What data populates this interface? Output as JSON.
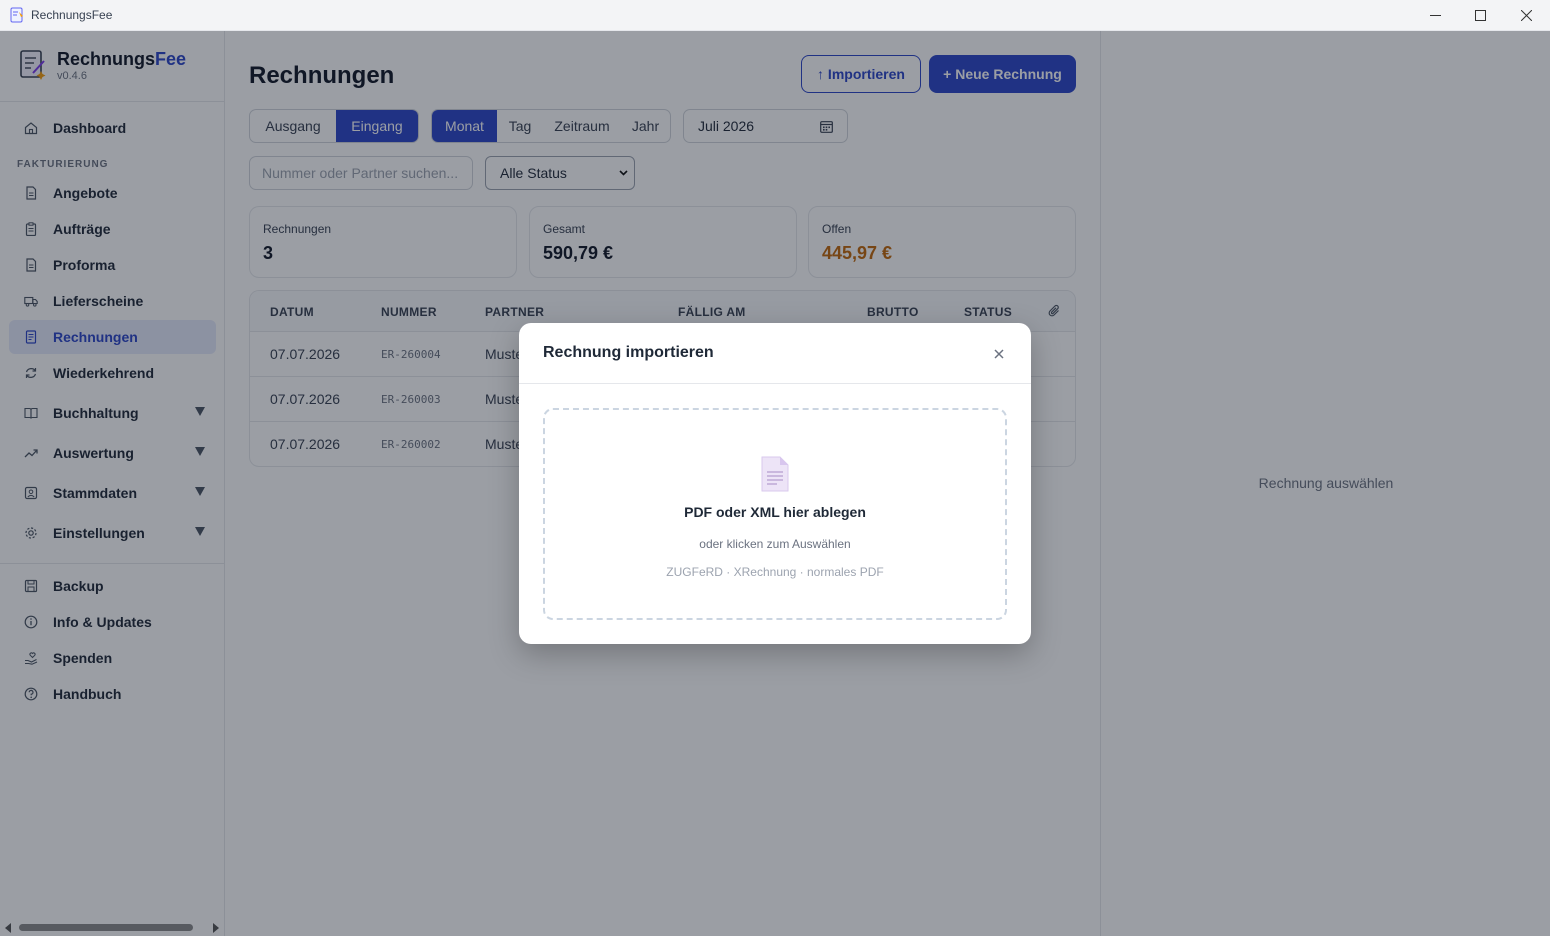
{
  "window": {
    "title": "RechnungsFee"
  },
  "brand": {
    "name_main": "Rechnungs",
    "name_accent": "Fee",
    "version": "v0.4.6"
  },
  "sidebar": {
    "dashboard": "Dashboard",
    "section_label": "FAKTURIERUNG",
    "items": [
      "Angebote",
      "Aufträge",
      "Proforma",
      "Lieferscheine",
      "Rechnungen",
      "Wiederkehrend"
    ],
    "groups": [
      "Buchhaltung",
      "Auswertung",
      "Stammdaten",
      "Einstellungen"
    ],
    "bottom": [
      "Backup",
      "Info & Updates",
      "Spenden",
      "Handbuch"
    ]
  },
  "main": {
    "title": "Rechnungen",
    "import_button": "↑ Importieren",
    "new_button": "+ Neue Rechnung",
    "direction": [
      "Ausgang",
      "Eingang"
    ],
    "period": [
      "Monat",
      "Tag",
      "Zeitraum",
      "Jahr"
    ],
    "date_value": "Juli 2026",
    "search_placeholder": "Nummer oder Partner suchen...",
    "status_filter": "Alle Status",
    "stats": [
      {
        "label": "Rechnungen",
        "value": "3"
      },
      {
        "label": "Gesamt",
        "value": "590,79 €"
      },
      {
        "label": "Offen",
        "value": "445,97 €"
      }
    ],
    "table": {
      "headers": [
        "DATUM",
        "NUMMER",
        "PARTNER",
        "FÄLLIG AM",
        "BRUTTO",
        "STATUS"
      ],
      "rows": [
        {
          "date": "07.07.2026",
          "number": "ER-260004",
          "partner": "Muste"
        },
        {
          "date": "07.07.2026",
          "number": "ER-260003",
          "partner": "Muste"
        },
        {
          "date": "07.07.2026",
          "number": "ER-260002",
          "partner": "Muste"
        }
      ]
    }
  },
  "right_panel": {
    "hint": "Rechnung auswählen"
  },
  "modal": {
    "title": "Rechnung importieren",
    "drop_title": "PDF oder XML hier ablegen",
    "drop_sub": "oder klicken zum Auswählen",
    "drop_formats": "ZUGFeRD · XRechnung · normales PDF"
  },
  "colors": {
    "accent": "#2b45c8",
    "open_amount": "#c2680a"
  }
}
